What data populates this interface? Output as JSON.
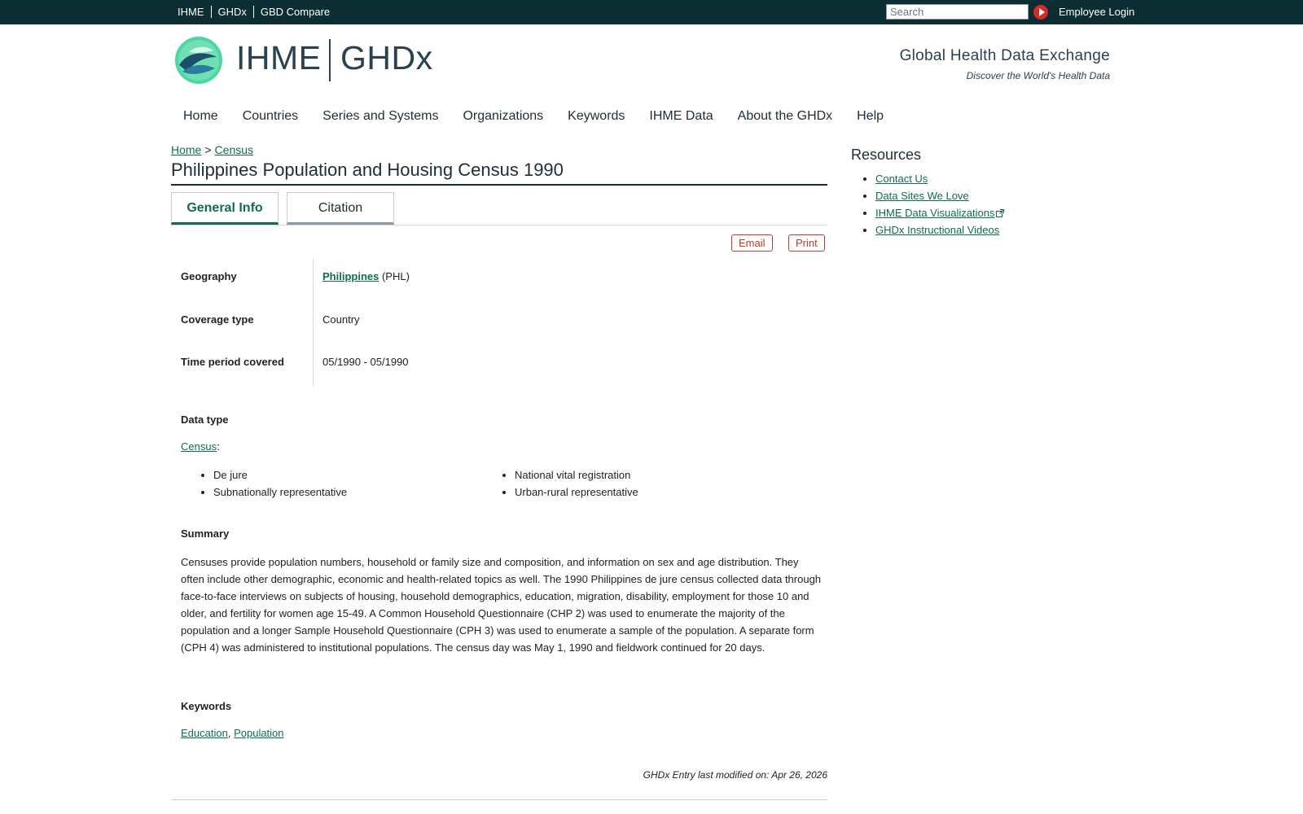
{
  "topbar": {
    "links": [
      "IHME",
      "GHDx",
      "GBD Compare"
    ],
    "search_placeholder": "Search",
    "employee_login": "Employee Login"
  },
  "header": {
    "brand_left": "IHME",
    "brand_right": "GHDx",
    "tagline": "Global Health Data Exchange",
    "subtagline": "Discover the World's Health Data"
  },
  "nav": {
    "items": [
      "Home",
      "Countries",
      "Series and Systems",
      "Organizations",
      "Keywords",
      "IHME Data",
      "About the GHDx",
      "Help"
    ]
  },
  "breadcrumb": {
    "home": "Home",
    "separator": ">",
    "current": "Census"
  },
  "page_title": "Philippines Population and Housing Census 1990",
  "tabs": {
    "general": "General Info",
    "citation": "Citation"
  },
  "actions": {
    "email": "Email",
    "print": "Print"
  },
  "info": {
    "geography_label": "Geography",
    "geography_link": "Philippines",
    "geography_code": "(PHL)",
    "coverage_label": "Coverage type",
    "coverage_value": "Country",
    "time_label": "Time period covered",
    "time_value": "05/1990 - 05/1990"
  },
  "data_type": {
    "label": "Data type",
    "link": "Census",
    "suffix": ":",
    "col1": [
      "De jure",
      "Subnationally representative"
    ],
    "col2": [
      "National vital registration",
      "Urban-rural representative"
    ]
  },
  "summary": {
    "label": "Summary",
    "text": "Censuses provide population numbers, household or family size and composition, and information on sex and age distribution. They often include other demographic, economic and health-related topics as well. The 1990 Philippines de jure census collected data through face-to-face interviews on subjects of housing, household demographics, education, migration, disability, employment for those 10 and older, and fertility for women age 15-49. A Common Household Questionnaire (CHP 2) was used to enumerate the majority of the population and a longer Sample Household Questionnaire (CPH 3) was used to enumerate a sample of the population. A separate form (CPH 4) was administered to institutional populations. The census day was May 1, 1990 and fieldwork continued for 20 days."
  },
  "keywords": {
    "label": "Keywords",
    "items": [
      "Education",
      "Population"
    ],
    "separator": ","
  },
  "modified": "GHDx Entry last modified on: Apr 26, 2026",
  "resources": {
    "title": "Resources",
    "items": [
      "Contact Us",
      "Data Sites We Love",
      "IHME Data Visualizations",
      "GHDx Instructional Videos"
    ]
  },
  "colors": {
    "topbar": "#0b2e33",
    "link": "#0f6e48",
    "action": "#c0392b"
  }
}
